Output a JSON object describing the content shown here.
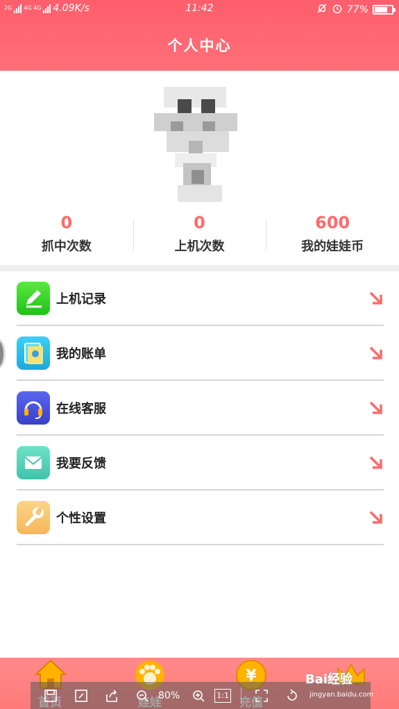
{
  "status_bar": {
    "network_small": "2G",
    "network_small2": "4G 4G",
    "speed": "4.09K/s",
    "time": "11:42",
    "battery_percent": "77%",
    "battery_level": 0.77
  },
  "header": {
    "title": "个人中心"
  },
  "stats": [
    {
      "value": "0",
      "label": "抓中次数"
    },
    {
      "value": "0",
      "label": "上机次数"
    },
    {
      "value": "600",
      "label": "我的娃娃币"
    }
  ],
  "menu": [
    {
      "label": "上机记录",
      "icon": "pencil-icon",
      "color": "#3bd12f"
    },
    {
      "label": "我的账单",
      "icon": "bill-icon",
      "color": "#29b6e8"
    },
    {
      "label": "在线客服",
      "icon": "headset-icon",
      "color": "#4f59e0"
    },
    {
      "label": "我要反馈",
      "icon": "mail-icon",
      "color": "#4dd0b6"
    },
    {
      "label": "个性设置",
      "icon": "wrench-icon",
      "color": "#f7c06a"
    }
  ],
  "tabbar": [
    {
      "label": "首页",
      "icon": "home-icon"
    },
    {
      "label": "娃娃",
      "icon": "paw-icon"
    },
    {
      "label": "充值",
      "icon": "yen-icon"
    },
    {
      "label": "",
      "icon": "crown-icon"
    }
  ],
  "viewer_toolbar": {
    "zoom": "80%",
    "actual_size": "1:1"
  },
  "watermark": {
    "text": "Bai经验",
    "url": "jingyan.baidu.com"
  },
  "colors": {
    "header": "#ff6470",
    "accent": "#ff6a6a",
    "arrow": "#ff6a6a"
  }
}
